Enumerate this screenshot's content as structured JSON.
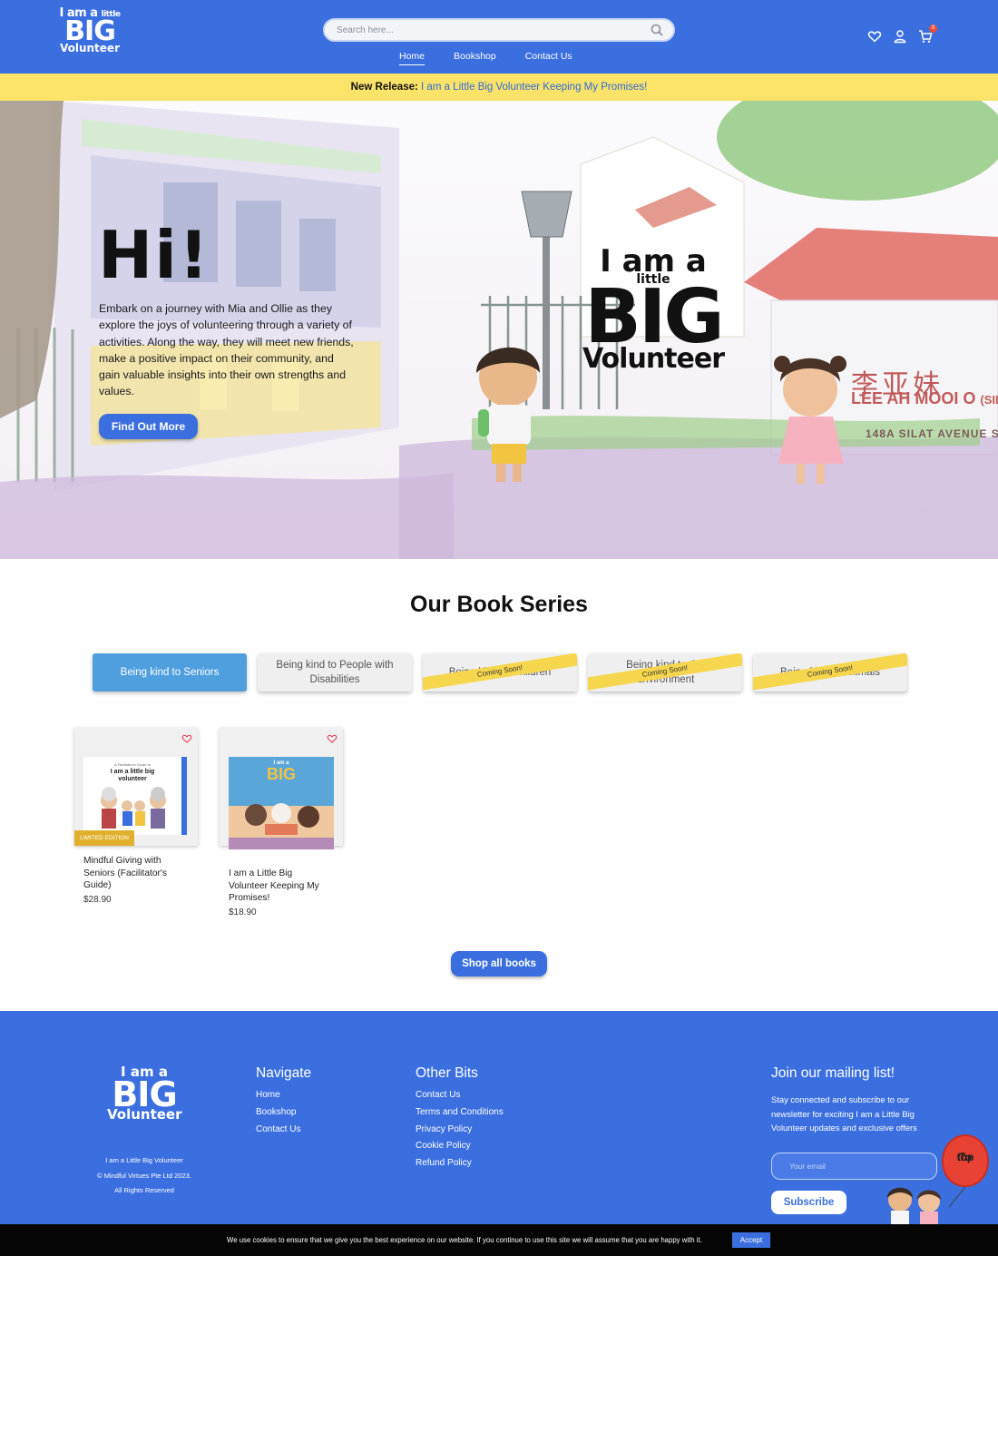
{
  "header": {
    "logo": {
      "line1": "I am a",
      "line1b": "little",
      "line2": "BIG",
      "line3": "Volunteer"
    },
    "search": {
      "placeholder": "Search here..."
    },
    "nav": [
      "Home",
      "Bookshop",
      "Contact Us"
    ],
    "cart_count": "0",
    "icons": [
      "heart-icon",
      "user-icon",
      "cart-icon",
      "search-icon"
    ]
  },
  "announcement": {
    "label": "New Release:",
    "link": "I am a Little Big Volunteer Keeping My Promises!"
  },
  "hero": {
    "greeting": "Hi!",
    "text": "Embark on a journey with Mia and Ollie as they explore the joys of volunteering through a variety of activities. Along the way, they will meet new friends, make a positive impact on their community, and gain valuable insights into their own strengths and values.",
    "button": "Find Out More",
    "logo": {
      "line1": "I am a",
      "line2": "little",
      "line3": "BIG",
      "line4": "Volunteer"
    },
    "sign_chinese": "李亚妹",
    "sign_name": "LEE AH MOOI O",
    "sign_sub": "(SILA",
    "sign_address": "148A SILAT AVENUE S"
  },
  "series": {
    "title": "Our Book Series",
    "tabs": [
      {
        "label": "Being kind to Seniors",
        "active": true,
        "ribbon": ""
      },
      {
        "label": "Being kind to People with Disabilities",
        "active": false,
        "ribbon": ""
      },
      {
        "label": "Being kind to Children",
        "active": false,
        "ribbon": "Coming Soon!"
      },
      {
        "label": "Being kind to the Environment",
        "active": false,
        "ribbon": "Coming Soon!"
      },
      {
        "label": "Being kind to Animals",
        "active": false,
        "ribbon": "Coming Soon!"
      }
    ]
  },
  "products": [
    {
      "name": "Mindful Giving with Seniors (Facilitator's Guide)",
      "price": "$28.90",
      "tag": "LIMITED EDITION",
      "cover_title": "I am a little big volunteer",
      "cover_kicker": "A Facilitator's Guide to"
    },
    {
      "name": "I am a Little Big Volunteer Keeping My Promises!",
      "price": "$18.90",
      "tag": "",
      "cover_title": "BIG",
      "cover_kicker": "I am a"
    }
  ],
  "shop_all": "Shop all books",
  "footer": {
    "logo": {
      "line1": "I am a",
      "line2": "BIG",
      "line3": "Volunteer"
    },
    "copy1": "I am a Little Big Volunteer",
    "copy2": "© Mindful Virtues Pte Ltd 2023.",
    "copy3": "All Rights Reserved",
    "navigate": {
      "title": "Navigate",
      "links": [
        "Home",
        "Bookshop",
        "Contact Us"
      ]
    },
    "other": {
      "title": "Other Bits",
      "links": [
        "Contact Us",
        "Terms and Conditions",
        "Privacy Policy",
        "Cookie Policy",
        "Refund Policy"
      ]
    },
    "mailing": {
      "title": "Join our mailing list!",
      "text": "Stay connected and subscribe to our newsletter for exciting I am a Little Big Volunteer updates and exclusive offers",
      "placeholder": "Your email",
      "button": "Subscribe"
    },
    "to_top": {
      "line1": "To",
      "line2": "the",
      "line3": "top"
    }
  },
  "cookie": {
    "text": "We use cookies to ensure that we give you the best experience on our website. If you continue to use this site we will assume that you are happy with it.",
    "button": "Accept"
  },
  "colors": {
    "brand_blue": "#3b6fe0",
    "banner_yellow": "#fbe269",
    "tab_active": "#4f9fdf",
    "limited_tag": "#e0b02d"
  }
}
